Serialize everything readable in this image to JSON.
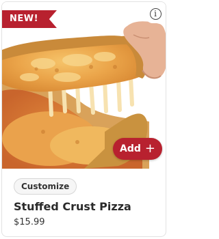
{
  "badge": {
    "label": "NEW!"
  },
  "info": {
    "glyph": "i"
  },
  "image": {
    "description_icon": "stuffed-crust-pizza-photo"
  },
  "add_button": {
    "label": "Add",
    "icon": "+"
  },
  "customize": {
    "label": "Customize"
  },
  "product": {
    "name": "Stuffed Crust Pizza",
    "price": "$15.99"
  },
  "colors": {
    "accent": "#b8212f",
    "text": "#2a2a2a",
    "chip_bg": "#f6f6f6"
  }
}
